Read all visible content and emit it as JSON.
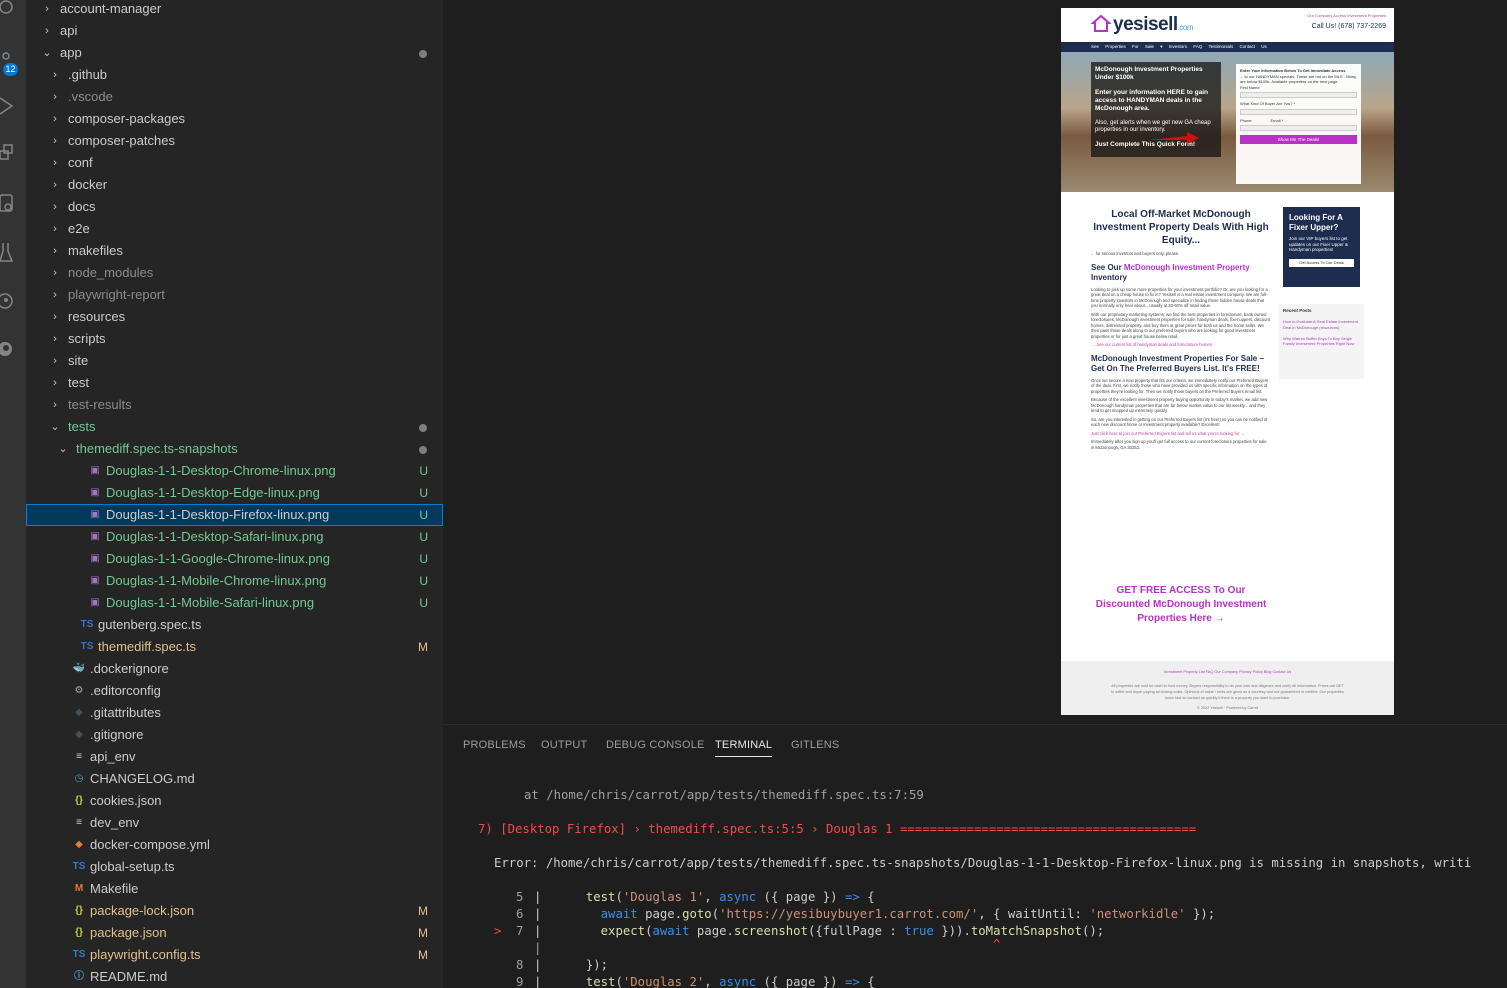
{
  "activity_bar": {
    "scm_badge": "12",
    "icons": [
      "search-icon",
      "source-control-icon",
      "run-debug-icon",
      "extensions-icon",
      "remote-explorer-icon",
      "testing-icon",
      "gitlens-icon",
      "github-icon"
    ]
  },
  "explorer": {
    "items": [
      {
        "label": "account-manager",
        "type": "folder",
        "collapsed": true,
        "depth": 0,
        "color": "normal"
      },
      {
        "label": "api",
        "type": "folder",
        "collapsed": true,
        "depth": 0,
        "color": "normal"
      },
      {
        "label": "app",
        "type": "folder",
        "collapsed": false,
        "depth": 0,
        "color": "normal",
        "dot": true
      },
      {
        "label": ".github",
        "type": "folder",
        "collapsed": true,
        "depth": 1,
        "color": "normal"
      },
      {
        "label": ".vscode",
        "type": "folder",
        "collapsed": true,
        "depth": 1,
        "color": "dim"
      },
      {
        "label": "composer-packages",
        "type": "folder",
        "collapsed": true,
        "depth": 1,
        "color": "normal"
      },
      {
        "label": "composer-patches",
        "type": "folder",
        "collapsed": true,
        "depth": 1,
        "color": "normal"
      },
      {
        "label": "conf",
        "type": "folder",
        "collapsed": true,
        "depth": 1,
        "color": "normal"
      },
      {
        "label": "docker",
        "type": "folder",
        "collapsed": true,
        "depth": 1,
        "color": "normal"
      },
      {
        "label": "docs",
        "type": "folder",
        "collapsed": true,
        "depth": 1,
        "color": "normal"
      },
      {
        "label": "e2e",
        "type": "folder",
        "collapsed": true,
        "depth": 1,
        "color": "normal"
      },
      {
        "label": "makefiles",
        "type": "folder",
        "collapsed": true,
        "depth": 1,
        "color": "normal"
      },
      {
        "label": "node_modules",
        "type": "folder",
        "collapsed": true,
        "depth": 1,
        "color": "dim"
      },
      {
        "label": "playwright-report",
        "type": "folder",
        "collapsed": true,
        "depth": 1,
        "color": "dim"
      },
      {
        "label": "resources",
        "type": "folder",
        "collapsed": true,
        "depth": 1,
        "color": "normal"
      },
      {
        "label": "scripts",
        "type": "folder",
        "collapsed": true,
        "depth": 1,
        "color": "normal"
      },
      {
        "label": "site",
        "type": "folder",
        "collapsed": true,
        "depth": 1,
        "color": "normal"
      },
      {
        "label": "test",
        "type": "folder",
        "collapsed": true,
        "depth": 1,
        "color": "normal"
      },
      {
        "label": "test-results",
        "type": "folder",
        "collapsed": true,
        "depth": 1,
        "color": "dim"
      },
      {
        "label": "tests",
        "type": "folder",
        "collapsed": false,
        "depth": 1,
        "color": "green",
        "dot": true
      },
      {
        "label": "themediff.spec.ts-snapshots",
        "type": "folder",
        "collapsed": false,
        "depth": 2,
        "color": "green",
        "dot": true
      },
      {
        "label": "Douglas-1-1-Desktop-Chrome-linux.png",
        "type": "image",
        "depth": 3,
        "color": "green",
        "status": "U"
      },
      {
        "label": "Douglas-1-1-Desktop-Edge-linux.png",
        "type": "image",
        "depth": 3,
        "color": "green",
        "status": "U"
      },
      {
        "label": "Douglas-1-1-Desktop-Firefox-linux.png",
        "type": "image",
        "depth": 3,
        "color": "white",
        "status": "U",
        "selected": true
      },
      {
        "label": "Douglas-1-1-Desktop-Safari-linux.png",
        "type": "image",
        "depth": 3,
        "color": "green",
        "status": "U"
      },
      {
        "label": "Douglas-1-1-Google-Chrome-linux.png",
        "type": "image",
        "depth": 3,
        "color": "green",
        "status": "U"
      },
      {
        "label": "Douglas-1-1-Mobile-Chrome-linux.png",
        "type": "image",
        "depth": 3,
        "color": "green",
        "status": "U"
      },
      {
        "label": "Douglas-1-1-Mobile-Safari-linux.png",
        "type": "image",
        "depth": 3,
        "color": "green",
        "status": "U"
      },
      {
        "label": "gutenberg.spec.ts",
        "type": "ts",
        "depth": 2,
        "color": "normal"
      },
      {
        "label": "themediff.spec.ts",
        "type": "ts",
        "depth": 2,
        "color": "yellow",
        "status": "M"
      },
      {
        "label": ".dockerignore",
        "type": "docker",
        "depth": 1,
        "color": "normal"
      },
      {
        "label": ".editorconfig",
        "type": "gear",
        "depth": 1,
        "color": "normal"
      },
      {
        "label": ".gitattributes",
        "type": "git",
        "depth": 1,
        "color": "normal"
      },
      {
        "label": ".gitignore",
        "type": "git",
        "depth": 1,
        "color": "normal"
      },
      {
        "label": "api_env",
        "type": "lines",
        "depth": 1,
        "color": "normal"
      },
      {
        "label": "CHANGELOG.md",
        "type": "clock",
        "depth": 1,
        "color": "normal"
      },
      {
        "label": "cookies.json",
        "type": "json",
        "depth": 1,
        "color": "normal"
      },
      {
        "label": "dev_env",
        "type": "lines",
        "depth": 1,
        "color": "normal"
      },
      {
        "label": "docker-compose.yml",
        "type": "compose",
        "depth": 1,
        "color": "normal"
      },
      {
        "label": "global-setup.ts",
        "type": "ts",
        "depth": 1,
        "color": "normal"
      },
      {
        "label": "Makefile",
        "type": "make",
        "depth": 1,
        "color": "normal"
      },
      {
        "label": "package-lock.json",
        "type": "json",
        "depth": 1,
        "color": "yellow",
        "status": "M"
      },
      {
        "label": "package.json",
        "type": "json",
        "depth": 1,
        "color": "yellow",
        "status": "M"
      },
      {
        "label": "playwright.config.ts",
        "type": "ts",
        "depth": 1,
        "color": "yellow",
        "status": "M"
      },
      {
        "label": "README.md",
        "type": "info",
        "depth": 1,
        "color": "normal"
      }
    ]
  },
  "preview": {
    "logo": "yesisell",
    "logo_suffix": ".com",
    "top_links": "Our Company   Access Investment Properties",
    "phone": "Call Us! (678) 737-2269",
    "nav": "See Properties For Sale ▾   Investors   FAQ   Testimonials   Contact Us",
    "hero_title": "McDonough Investment Properties Under $100k",
    "hero_text": "Enter your information HERE to gain access to HANDYMAN deals in the McDonough area.",
    "hero_small": "Also, get alerts when we get new GA cheap properties in our inventory.",
    "hero_cta": "Just Complete This Quick Form!",
    "form_title": "Enter Your Information Below To Get Immediate Access",
    "form_text": "... to our HANDYMAN specials. These are not on the MLS - Many are below $100k. Available properties on the next page.",
    "form_first": "First Name",
    "form_kind": "What Kind Of Buyer Are You? *",
    "form_phone": "Phone",
    "form_email": "Email *",
    "form_button": "Show Me The Deals!",
    "main_title": "Local Off-Market McDonough Investment Property Deals With High Equity...",
    "main_for": "... for serious investors and buyers only, please.",
    "see_our_prefix": "See Our",
    "see_our_link": "McDonough Investment Property",
    "see_our_suffix": "Inventory",
    "body1": "Looking to pick up some more properties for your investment portfolio? Or, are you looking for a great deal on a cheap house to fix in? Yesisell is a real estate investment company. We are full-time property investors in McDonough and specialize in finding those hidden house deals that you normally only hear about... usually at 30-50% off retail value.",
    "body2": "With our proprietary marketing systems, we find the best properties in foreclosure, bank owned foreclosures, McDonough investment properties for sale, handyman deals, fixer uppers, discount homes, distressed property, and buy them at great prices for both us and the home seller. We then pass those deals along to our preferred buyers who are looking for good investment properties or for just a great house below retail.",
    "body_link": "→ See our current list of handyman deals and foreclosure homes",
    "section2_title": "McDonough Investment Properties For Sale – Get On The Preferred Buyers List. It's FREE!",
    "body3": "Once we secure a new property that fits our criteria, we immediately notify our Preferred Buyers of the deal. First, we notify those who have provided us with specific information on the types of properties they're looking for. Then we notify those buyers on the Preferred Buyers email list.",
    "body4": "Because of the excellent investment property buying opportunity in today's market, we add new McDonough handyman properties that are far below market value to our list weekly... and they tend to get snapped up extremely quickly.",
    "body5": "So, are you interested in getting on our Preferred Buyers list (it's free!) so you can be notified of each new discount home or investment property available? Excellent!",
    "body_link2": "Just click here to join our Preferred Buyers list and tell us what you're looking for →",
    "body6": "Immediately after you sign up you'll get full access to our current foreclosure properties for sale in McDonough, GA 30253.",
    "cta": "GET FREE ACCESS To Our Discounted McDonough Investment Properties Here →",
    "side_title": "Looking For A Fixer Upper?",
    "side_text": "Join our VIP buyers list to get updates on our Fixer Upper & Handyman properties!",
    "side_button": "Get Access To Our Deals",
    "recent_title": "Recent Posts",
    "recent1": "How to Evaluate A Real Estate Investment Deal in McDonough (resources)",
    "recent2": "Why Warren Buffet Says To Buy Single Family Investment Properties Right Now",
    "footer_links": "Investment Property List   FAQ   Our Company   Privacy Policy   Blog   Contact Us",
    "footer_text": "All properties are sold for cash to fund money. Buyers responsibility to do your own due diligence and verify all information. Prices are NET to seller and buyer paying all closing costs. Opinions of value / rents are given as a courtesy and not guaranteed or verified. Our properties move fast so contact us quickly if there is a property you want to purchase.",
    "footer_copy": "© 2022 Yesisell · Powered by Carrot"
  },
  "panel": {
    "tabs": [
      "PROBLEMS",
      "OUTPUT",
      "DEBUG CONSOLE",
      "TERMINAL",
      "GITLENS"
    ],
    "active_tab": "TERMINAL",
    "line_at": "at /home/chris/carrot/app/tests/themediff.spec.ts:7:59",
    "line_fail": "7) [Desktop Firefox] › themediff.spec.ts:5:5 › Douglas 1 ========================================",
    "line_error": "Error: /home/chris/carrot/app/tests/themediff.spec.ts-snapshots/Douglas-1-1-Desktop-Firefox-linux.png is missing in snapshots, writi",
    "code": {
      "n5": "5",
      "n6": "6",
      "n7": "7",
      "n8": "8",
      "n9": "9",
      "marker": ">",
      "caret": "^"
    }
  }
}
